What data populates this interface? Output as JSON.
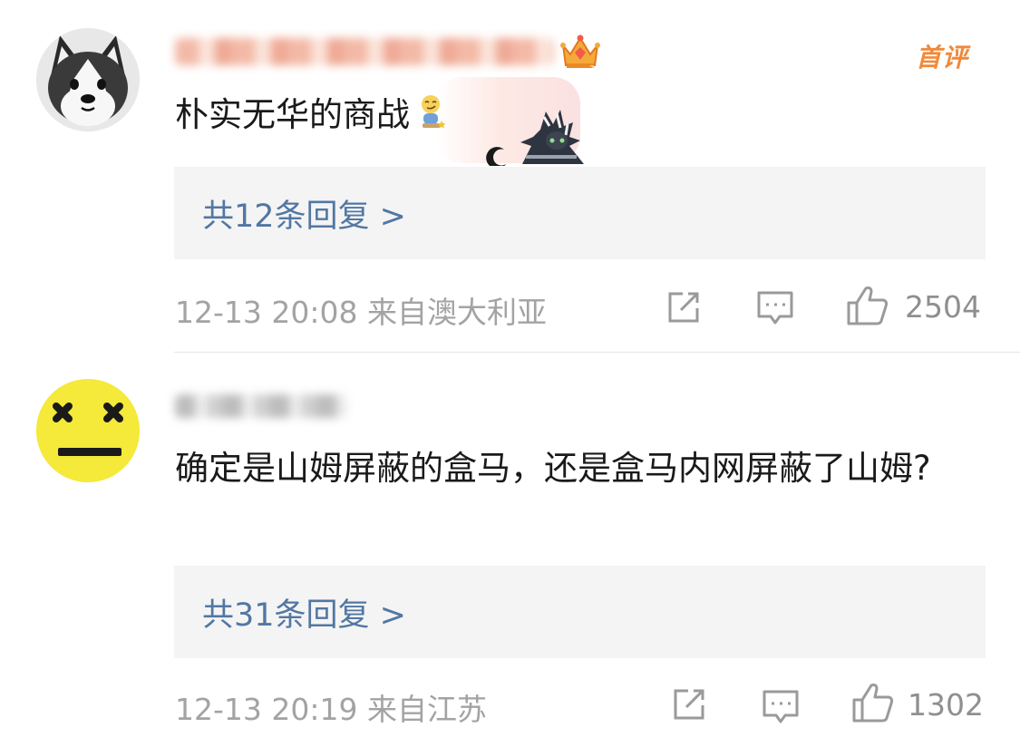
{
  "comments": [
    {
      "badge": "首评",
      "text": "朴实无华的商战",
      "reply_link": "共12条回复 >",
      "meta": "12-13 20:08 来自澳大利亚",
      "likes": "2504"
    },
    {
      "text": "确定是山姆屏蔽的盒马，还是盒马内网屏蔽了山姆?",
      "reply_link": "共31条回复 >",
      "meta": "12-13 20:19 来自江苏",
      "likes": "1302"
    }
  ],
  "colors": {
    "link": "#5277a3",
    "meta": "#a3a3a3",
    "badge": "#f08a3c",
    "reply_bg": "#f4f4f4"
  },
  "icons": [
    "husky-avatar",
    "dizzy-face-avatar",
    "crown-icon",
    "smirk-emoji-icon",
    "cat-sticker-icon",
    "share-icon",
    "comment-icon",
    "like-icon"
  ]
}
